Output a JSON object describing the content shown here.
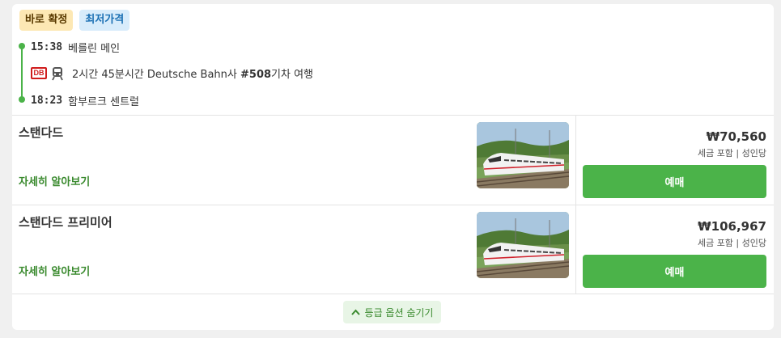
{
  "badges": [
    "바로 확정",
    "최저가격"
  ],
  "itinerary": {
    "departure": {
      "time": "15:38",
      "station": "베를린 메인"
    },
    "journey": {
      "duration": "2시간 45분시간",
      "operator": "Deutsche Bahn사",
      "train_number": "#508",
      "suffix": "기차 여행",
      "operator_logo": "DB"
    },
    "arrival": {
      "time": "18:23",
      "station": "함부르크 센트럴"
    }
  },
  "fares": [
    {
      "name": "스탠다드",
      "more_link": "자세히 알아보기",
      "price": "₩70,560",
      "tax_note": "세금 포함 | 성인당",
      "button": "예매"
    },
    {
      "name": "스탠다드 프리미어",
      "more_link": "자세히 알아보기",
      "price": "₩106,967",
      "tax_note": "세금 포함 | 성인당",
      "button": "예매"
    }
  ],
  "hide_options": "등급 옵션 숨기기",
  "colors": {
    "accent_green": "#4bb349",
    "link_green": "#3a8a2e",
    "badge_orange": "#fde8b4",
    "badge_blue": "#d8ecfb",
    "db_red": "#d01c1c"
  },
  "icons": [
    "db-logo",
    "train-icon",
    "chevron-up-icon",
    "train-photo"
  ]
}
